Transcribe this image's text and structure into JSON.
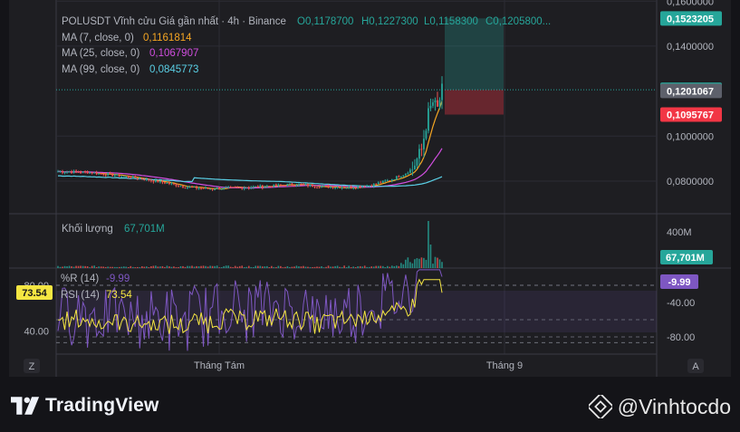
{
  "chart_data": [
    {
      "type": "candlestick",
      "name": "price",
      "header": {
        "symbol": "POLUSDT Vĩnh cửu Giá gần nhất · 4h · Binance",
        "o": "O0,1178700",
        "h": "H0,1227300",
        "l": "L0,1158300",
        "c": "C0,1205800..."
      },
      "ma": [
        {
          "label": "MA (7, close, 0)",
          "value": "0,1161814",
          "color": "#f5a623"
        },
        {
          "label": "MA (25, close, 0)",
          "value": "0,1067907",
          "color": "#d14ee0"
        },
        {
          "label": "MA (99, close, 0)",
          "value": "0,0845773",
          "color": "#5ad0e6"
        }
      ],
      "y_ticks": [
        "0,1600000",
        "0,1400000",
        "0,1000000",
        "0,0800000"
      ],
      "y_tick_values": [
        0.16,
        0.14,
        0.1,
        0.08
      ],
      "ylim": [
        0.0655,
        0.1605
      ],
      "tags": [
        {
          "text": "0,1523205",
          "value": 0.1523205,
          "bg": "#26a69a"
        },
        {
          "text": "0,1205800",
          "value": 0.12058,
          "bg": "#26a69a"
        },
        {
          "text": "0,1201067",
          "value": 0.1201067,
          "bg": "#5d606b"
        },
        {
          "text": "0,1095767",
          "value": 0.1095767,
          "bg": "#f23645"
        }
      ],
      "position": {
        "entry": 0.12058,
        "target": 0.1523205,
        "stop": 0.1095767
      },
      "colors": {
        "up": "#26a69a",
        "down": "#ef5350"
      }
    },
    {
      "type": "bar",
      "name": "volume",
      "label": "Khối lượng",
      "value": "67,701M",
      "y_ticks": [
        "400M"
      ],
      "y_tick_values": [
        400
      ],
      "ylim": [
        0,
        600
      ],
      "tags": [
        {
          "text": "67,701M",
          "bg": "#26a69a"
        }
      ]
    },
    {
      "type": "line",
      "name": "oscillators",
      "series": [
        {
          "name": "%R (14)",
          "value": "-9.99",
          "color": "#7e57c2"
        },
        {
          "name": "RSI (14)",
          "value": "73.54",
          "color": "#f5e642"
        }
      ],
      "y_ticks_left": [
        "80.00",
        "40.00"
      ],
      "y_ticks_right": [
        "-40.00",
        "-80.00"
      ],
      "rsi_ylim": [
        20,
        95
      ],
      "tags": [
        {
          "text": "73.54",
          "side": "left",
          "bg": "#f5e642"
        },
        {
          "text": "-9.99",
          "side": "right",
          "bg": "#7e57c2"
        }
      ]
    }
  ],
  "x_axis": {
    "labels": [
      "Tháng Tám",
      "Tháng 9"
    ]
  },
  "ui": {
    "left_button": "Z",
    "right_button": "A"
  },
  "footer": {
    "brand": "TradingView",
    "user": "@Vinhtocdo"
  }
}
